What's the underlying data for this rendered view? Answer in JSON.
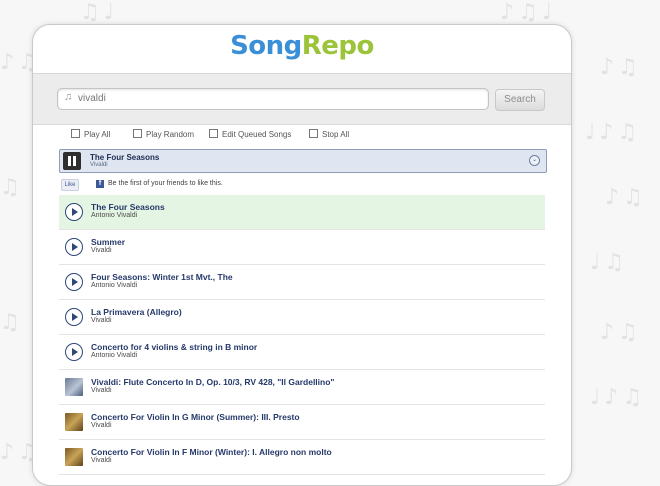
{
  "app": {
    "logo_part1": "Song",
    "logo_part2": "Repo"
  },
  "search": {
    "value": "vivaldi",
    "button_label": "Search"
  },
  "toolbar": [
    {
      "label": "Play All"
    },
    {
      "label": "Play Random"
    },
    {
      "label": "Edit Queued Songs"
    },
    {
      "label": "Stop All"
    }
  ],
  "player": {
    "title": "The Four Seasons",
    "artist": "Vivaldi"
  },
  "facebook": {
    "like_label": "Like",
    "text": "Be the first of your friends to like this."
  },
  "songs": [
    {
      "title": "The Four Seasons",
      "artist": "Antonio Vivaldi",
      "icon": "play-icon"
    },
    {
      "title": "Summer",
      "artist": "Vivaldi",
      "icon": "play-icon"
    },
    {
      "title": "Four Seasons: Winter 1st Mvt., The",
      "artist": "Antonio Vivaldi",
      "icon": "play-icon"
    },
    {
      "title": "La Primavera (Allegro)",
      "artist": "Vivaldi",
      "icon": "play-icon"
    },
    {
      "title": "Concerto for 4 violins & string in B minor",
      "artist": "Antonio Vivaldi",
      "icon": "play-icon"
    },
    {
      "title": "Vivaldi: Flute Concerto In D, Op. 10/3, RV 428, \"Il Gardellino\"",
      "artist": "Vivaldi",
      "icon": "album-art"
    },
    {
      "title": "Concerto For Violin In G Minor (Summer): III. Presto",
      "artist": "Vivaldi",
      "icon": "album-art"
    },
    {
      "title": "Concerto For Violin In F Minor (Winter): I. Allegro non molto",
      "artist": "Vivaldi",
      "icon": "album-art"
    }
  ],
  "colors": {
    "brand_blue": "#3b8fd6",
    "brand_green": "#9bc43a",
    "active_row": "#e5f5e3"
  }
}
